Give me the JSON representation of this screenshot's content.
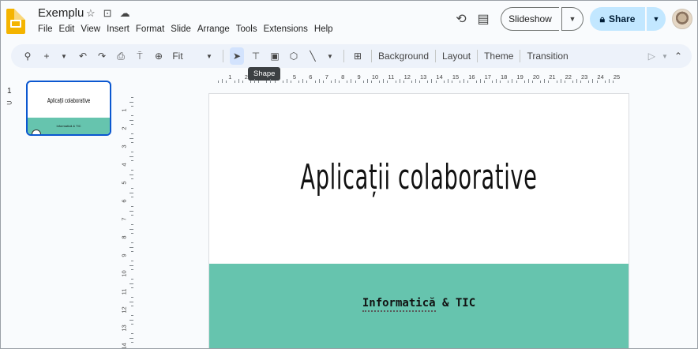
{
  "header": {
    "doc_title": "Exemplu",
    "title_icons": [
      "star-icon",
      "move-to-folder-icon",
      "cloud-saved-icon"
    ],
    "menu": [
      "File",
      "Edit",
      "View",
      "Insert",
      "Format",
      "Slide",
      "Arrange",
      "Tools",
      "Extensions",
      "Help"
    ],
    "slideshow_label": "Slideshow",
    "share_label": "Share"
  },
  "toolbar": {
    "zoom_label": "Fit",
    "background_label": "Background",
    "layout_label": "Layout",
    "theme_label": "Theme",
    "transition_label": "Transition",
    "tooltip": "Shape"
  },
  "filmstrip": {
    "slide_number": "1",
    "thumb_title": "Aplicații colaborative",
    "thumb_subtitle": "Informatică & TIC"
  },
  "rulers": {
    "horizontal": [
      "1",
      "2",
      "3",
      "4",
      "5",
      "6",
      "7",
      "8",
      "9",
      "10",
      "11",
      "12",
      "13",
      "14",
      "15",
      "16",
      "17",
      "18",
      "19",
      "20",
      "21",
      "22",
      "23",
      "24",
      "25"
    ],
    "vertical": [
      "1",
      "2",
      "3",
      "4",
      "5",
      "6",
      "7",
      "8",
      "9",
      "10",
      "11",
      "12",
      "13",
      "14"
    ]
  },
  "slide": {
    "title": "Aplicații colaborative",
    "subtitle_word": "Informatică",
    "subtitle_rest": " & TIC",
    "band_color": "#66c4ae"
  }
}
